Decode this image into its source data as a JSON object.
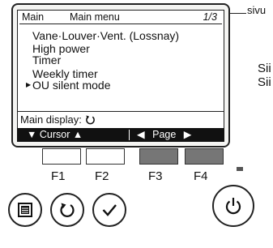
{
  "screen": {
    "header": {
      "left": "Main",
      "center": "Main menu",
      "page": "1/3"
    },
    "menu_items": [
      "Vane·Louver·Vent. (Lossnay)",
      "High power",
      "Timer",
      "Weekly timer",
      "OU silent mode"
    ],
    "selected_item_index": 4,
    "main_display_label": "Main display:",
    "footer": {
      "cursor_label": "Cursor",
      "page_label": "Page"
    }
  },
  "annotations": {
    "page_callout": "sivu",
    "side_text_1": "Sii",
    "side_text_2": "Sii"
  },
  "function_buttons": [
    {
      "label": "F1",
      "shaded": false
    },
    {
      "label": "F2",
      "shaded": false
    },
    {
      "label": "F3",
      "shaded": true
    },
    {
      "label": "F4",
      "shaded": true
    }
  ],
  "icons": [
    "menu-icon",
    "return-icon",
    "check-icon",
    "power-icon"
  ],
  "colors": {
    "lcd_footer_bg": "#111111",
    "shaded_button": "#767676"
  }
}
